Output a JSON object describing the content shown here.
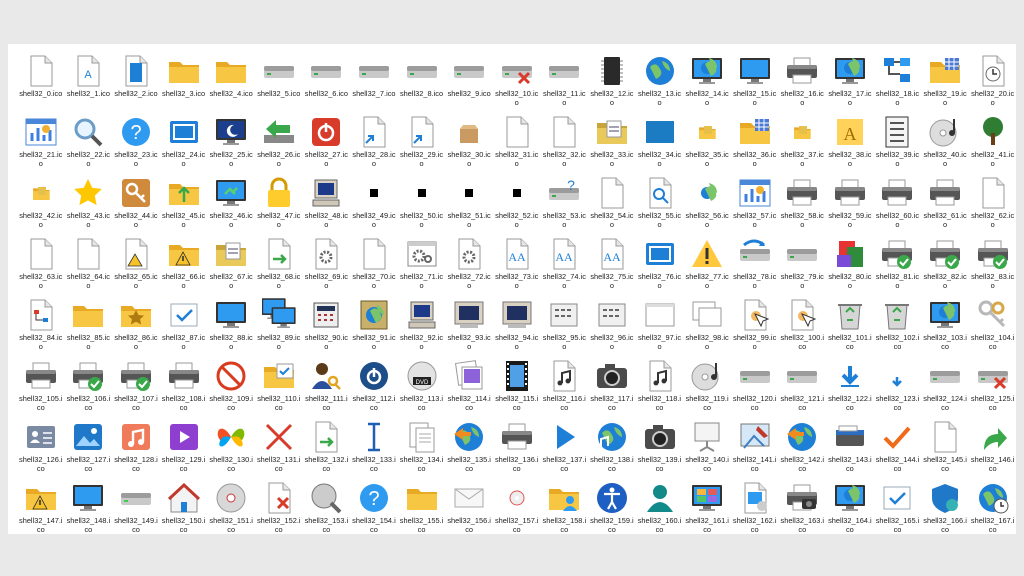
{
  "icons": [
    {
      "label": "shell32_0.ico",
      "kind": "doc"
    },
    {
      "label": "shell32_1.ico",
      "kind": "doc-a"
    },
    {
      "label": "shell32_2.ico",
      "kind": "doc-blue"
    },
    {
      "label": "shell32_3.ico",
      "kind": "folder"
    },
    {
      "label": "shell32_4.ico",
      "kind": "folder"
    },
    {
      "label": "shell32_5.ico",
      "kind": "drive"
    },
    {
      "label": "shell32_6.ico",
      "kind": "drive"
    },
    {
      "label": "shell32_7.ico",
      "kind": "drive"
    },
    {
      "label": "shell32_8.ico",
      "kind": "drive"
    },
    {
      "label": "shell32_9.ico",
      "kind": "drive"
    },
    {
      "label": "shell32_10.ico",
      "kind": "drive-x"
    },
    {
      "label": "shell32_11.ico",
      "kind": "drive"
    },
    {
      "label": "shell32_12.ico",
      "kind": "chip"
    },
    {
      "label": "shell32_13.ico",
      "kind": "globe"
    },
    {
      "label": "shell32_14.ico",
      "kind": "monitor-globe"
    },
    {
      "label": "shell32_15.ico",
      "kind": "monitor"
    },
    {
      "label": "shell32_16.ico",
      "kind": "printer"
    },
    {
      "label": "shell32_17.ico",
      "kind": "monitor-globe"
    },
    {
      "label": "shell32_18.ico",
      "kind": "network"
    },
    {
      "label": "shell32_19.ico",
      "kind": "folder-grid"
    },
    {
      "label": "shell32_20.ico",
      "kind": "clock-doc"
    },
    {
      "label": "shell32_21.ico",
      "kind": "chart-window"
    },
    {
      "label": "shell32_22.ico",
      "kind": "magnifier"
    },
    {
      "label": "shell32_23.ico",
      "kind": "help"
    },
    {
      "label": "shell32_24.ico",
      "kind": "window-blue"
    },
    {
      "label": "shell32_25.ico",
      "kind": "monitor-moon"
    },
    {
      "label": "shell32_26.ico",
      "kind": "arrow-green"
    },
    {
      "label": "shell32_27.ico",
      "kind": "power"
    },
    {
      "label": "shell32_28.ico",
      "kind": "doc-shortcut"
    },
    {
      "label": "shell32_29.ico",
      "kind": "doc-shortcut"
    },
    {
      "label": "shell32_30.ico",
      "kind": "box"
    },
    {
      "label": "shell32_31.ico",
      "kind": "recycle"
    },
    {
      "label": "shell32_32.ico",
      "kind": "recycle"
    },
    {
      "label": "shell32_33.ico",
      "kind": "folder-doc"
    },
    {
      "label": "shell32_34.ico",
      "kind": "rect-blue"
    },
    {
      "label": "shell32_35.ico",
      "kind": "folder-small"
    },
    {
      "label": "shell32_36.ico",
      "kind": "folder-grid"
    },
    {
      "label": "shell32_37.ico",
      "kind": "folder-small"
    },
    {
      "label": "shell32_38.ico",
      "kind": "font-a"
    },
    {
      "label": "shell32_39.ico",
      "kind": "list-panel"
    },
    {
      "label": "shell32_40.ico",
      "kind": "disc-music"
    },
    {
      "label": "shell32_41.ico",
      "kind": "tree"
    },
    {
      "label": "shell32_42.ico",
      "kind": "folder-small"
    },
    {
      "label": "shell32_43.ico",
      "kind": "star"
    },
    {
      "label": "shell32_44.ico",
      "kind": "key"
    },
    {
      "label": "shell32_45.ico",
      "kind": "folder-up"
    },
    {
      "label": "shell32_46.ico",
      "kind": "monitor-sync"
    },
    {
      "label": "shell32_47.ico",
      "kind": "lock"
    },
    {
      "label": "shell32_48.ico",
      "kind": "computer-old"
    },
    {
      "label": "shell32_49.ico",
      "kind": "black"
    },
    {
      "label": "shell32_50.ico",
      "kind": "black"
    },
    {
      "label": "shell32_51.ico",
      "kind": "black"
    },
    {
      "label": "shell32_52.ico",
      "kind": "black"
    },
    {
      "label": "shell32_53.ico",
      "kind": "drive-help"
    },
    {
      "label": "shell32_54.ico",
      "kind": "doc"
    },
    {
      "label": "shell32_55.ico",
      "kind": "doc-search"
    },
    {
      "label": "shell32_56.ico",
      "kind": "small-globe"
    },
    {
      "label": "shell32_57.ico",
      "kind": "chart-window"
    },
    {
      "label": "shell32_58.ico",
      "kind": "printer"
    },
    {
      "label": "shell32_59.ico",
      "kind": "printer"
    },
    {
      "label": "shell32_60.ico",
      "kind": "printer"
    },
    {
      "label": "shell32_61.ico",
      "kind": "printer"
    },
    {
      "label": "shell32_62.ico",
      "kind": "recycle"
    },
    {
      "label": "shell32_63.ico",
      "kind": "recycle"
    },
    {
      "label": "shell32_64.ico",
      "kind": "recycle"
    },
    {
      "label": "shell32_65.ico",
      "kind": "doc-warn"
    },
    {
      "label": "shell32_66.ico",
      "kind": "folder-warn"
    },
    {
      "label": "shell32_67.ico",
      "kind": "folder-doc"
    },
    {
      "label": "shell32_68.ico",
      "kind": "doc-arrow"
    },
    {
      "label": "shell32_69.ico",
      "kind": "gear-doc"
    },
    {
      "label": "shell32_70.ico",
      "kind": "doc"
    },
    {
      "label": "shell32_71.ico",
      "kind": "gear-window"
    },
    {
      "label": "shell32_72.ico",
      "kind": "gear-doc"
    },
    {
      "label": "shell32_73.ico",
      "kind": "font-doc"
    },
    {
      "label": "shell32_74.ico",
      "kind": "font-doc"
    },
    {
      "label": "shell32_75.ico",
      "kind": "font-doc"
    },
    {
      "label": "shell32_76.ico",
      "kind": "window-blue"
    },
    {
      "label": "shell32_77.ico",
      "kind": "warning"
    },
    {
      "label": "shell32_78.ico",
      "kind": "drive-arrow"
    },
    {
      "label": "shell32_79.ico",
      "kind": "drive"
    },
    {
      "label": "shell32_80.ico",
      "kind": "installer"
    },
    {
      "label": "shell32_81.ico",
      "kind": "printer-check"
    },
    {
      "label": "shell32_82.ico",
      "kind": "printer-check"
    },
    {
      "label": "shell32_83.ico",
      "kind": "printer-check"
    },
    {
      "label": "shell32_84.ico",
      "kind": "network-doc"
    },
    {
      "label": "shell32_85.ico",
      "kind": "folder"
    },
    {
      "label": "shell32_86.ico",
      "kind": "folder-star"
    },
    {
      "label": "shell32_87.ico",
      "kind": "checkbox"
    },
    {
      "label": "shell32_88.ico",
      "kind": "monitor"
    },
    {
      "label": "shell32_89.ico",
      "kind": "monitors"
    },
    {
      "label": "shell32_90.ico",
      "kind": "calc"
    },
    {
      "label": "shell32_91.ico",
      "kind": "book-globe"
    },
    {
      "label": "shell32_92.ico",
      "kind": "computer-old"
    },
    {
      "label": "shell32_93.ico",
      "kind": "monitor-old"
    },
    {
      "label": "shell32_94.ico",
      "kind": "monitor-old"
    },
    {
      "label": "shell32_95.ico",
      "kind": "panel"
    },
    {
      "label": "shell32_96.ico",
      "kind": "panel"
    },
    {
      "label": "shell32_97.ico",
      "kind": "window-white"
    },
    {
      "label": "shell32_98.ico",
      "kind": "windows-white"
    },
    {
      "label": "shell32_99.ico",
      "kind": "doc-cursor"
    },
    {
      "label": "shell32_100.ico",
      "kind": "doc-cursor"
    },
    {
      "label": "shell32_101.ico",
      "kind": "trash-bin"
    },
    {
      "label": "shell32_102.ico",
      "kind": "trash-bin"
    },
    {
      "label": "shell32_103.ico",
      "kind": "monitor-globe"
    },
    {
      "label": "shell32_104.ico",
      "kind": "keys"
    },
    {
      "label": "shell32_105.ico",
      "kind": "printer"
    },
    {
      "label": "shell32_106.ico",
      "kind": "printer-check"
    },
    {
      "label": "shell32_107.ico",
      "kind": "printer-check"
    },
    {
      "label": "shell32_108.ico",
      "kind": "printer"
    },
    {
      "label": "shell32_109.ico",
      "kind": "no-sign"
    },
    {
      "label": "shell32_110.ico",
      "kind": "folder-check"
    },
    {
      "label": "shell32_111.ico",
      "kind": "user-key"
    },
    {
      "label": "shell32_112.ico",
      "kind": "power-blue"
    },
    {
      "label": "shell32_113.ico",
      "kind": "dvd"
    },
    {
      "label": "shell32_114.ico",
      "kind": "pictures"
    },
    {
      "label": "shell32_115.ico",
      "kind": "film"
    },
    {
      "label": "shell32_116.ico",
      "kind": "music-doc"
    },
    {
      "label": "shell32_117.ico",
      "kind": "camera"
    },
    {
      "label": "shell32_118.ico",
      "kind": "music-doc"
    },
    {
      "label": "shell32_119.ico",
      "kind": "disc-music"
    },
    {
      "label": "shell32_120.ico",
      "kind": "drive"
    },
    {
      "label": "shell32_121.ico",
      "kind": "drive"
    },
    {
      "label": "shell32_122.ico",
      "kind": "download"
    },
    {
      "label": "shell32_123.ico",
      "kind": "download-small"
    },
    {
      "label": "shell32_124.ico",
      "kind": "drive"
    },
    {
      "label": "shell32_125.ico",
      "kind": "drive-x"
    },
    {
      "label": "shell32_126.ico",
      "kind": "contact"
    },
    {
      "label": "shell32_127.ico",
      "kind": "image-blue"
    },
    {
      "label": "shell32_128.ico",
      "kind": "music-tile"
    },
    {
      "label": "shell32_129.ico",
      "kind": "video-tile"
    },
    {
      "label": "shell32_130.ico",
      "kind": "butterfly"
    },
    {
      "label": "shell32_131.ico",
      "kind": "x-red"
    },
    {
      "label": "shell32_132.ico",
      "kind": "doc-arrow"
    },
    {
      "label": "shell32_133.ico",
      "kind": "text-cursor"
    },
    {
      "label": "shell32_134.ico",
      "kind": "docs"
    },
    {
      "label": "shell32_135.ico",
      "kind": "globe-arrow"
    },
    {
      "label": "shell32_136.ico",
      "kind": "printer"
    },
    {
      "label": "shell32_137.ico",
      "kind": "play"
    },
    {
      "label": "shell32_138.ico",
      "kind": "globe-music"
    },
    {
      "label": "shell32_139.ico",
      "kind": "camera"
    },
    {
      "label": "shell32_140.ico",
      "kind": "projector"
    },
    {
      "label": "shell32_141.ico",
      "kind": "paint"
    },
    {
      "label": "shell32_142.ico",
      "kind": "globe-arrow"
    },
    {
      "label": "shell32_143.ico",
      "kind": "scanner"
    },
    {
      "label": "shell32_144.ico",
      "kind": "check-orange"
    },
    {
      "label": "shell32_145.ico",
      "kind": "recycle"
    },
    {
      "label": "shell32_146.ico",
      "kind": "arrow-curve-green"
    },
    {
      "label": "shell32_147.ico",
      "kind": "folder-warn"
    },
    {
      "label": "shell32_148.ico",
      "kind": "monitor"
    },
    {
      "label": "shell32_149.ico",
      "kind": "drive-green"
    },
    {
      "label": "shell32_150.ico",
      "kind": "house"
    },
    {
      "label": "shell32_151.ico",
      "kind": "disc"
    },
    {
      "label": "shell32_152.ico",
      "kind": "doc-x"
    },
    {
      "label": "shell32_153.ico",
      "kind": "disc-search"
    },
    {
      "label": "shell32_154.ico",
      "kind": "help"
    },
    {
      "label": "shell32_155.ico",
      "kind": "folder"
    },
    {
      "label": "shell32_156.ico",
      "kind": "envelope"
    },
    {
      "label": "shell32_157.ico",
      "kind": "small-disc"
    },
    {
      "label": "shell32_158.ico",
      "kind": "folder-users"
    },
    {
      "label": "shell32_159.ico",
      "kind": "accessibility"
    },
    {
      "label": "shell32_160.ico",
      "kind": "user-teal"
    },
    {
      "label": "shell32_161.ico",
      "kind": "monitor-tiles"
    },
    {
      "label": "shell32_162.ico",
      "kind": "doc-window"
    },
    {
      "label": "shell32_163.ico",
      "kind": "printer-camera"
    },
    {
      "label": "shell32_164.ico",
      "kind": "monitor-globe"
    },
    {
      "label": "shell32_165.ico",
      "kind": "checkbox"
    },
    {
      "label": "shell32_166.ico",
      "kind": "shield-globe"
    },
    {
      "label": "shell32_167.ico",
      "kind": "globe-clock"
    }
  ]
}
